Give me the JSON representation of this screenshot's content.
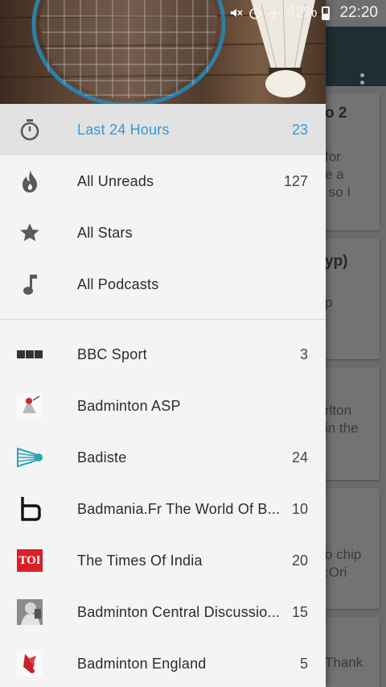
{
  "status_bar": {
    "battery": "42%",
    "time": "22:20"
  },
  "background": {
    "snippets": [
      "o 2",
      "for\ne a\n so I",
      "yp)",
      "p",
      "rlton\nin the",
      "o chip\n:Ori",
      "Thank"
    ]
  },
  "nav": [
    {
      "icon": "stopwatch-icon",
      "label": "Last 24 Hours",
      "count": "23",
      "active": true
    },
    {
      "icon": "flame-icon",
      "label": "All Unreads",
      "count": "127"
    },
    {
      "icon": "star-icon",
      "label": "All Stars",
      "count": ""
    },
    {
      "icon": "music-note-icon",
      "label": "All Podcasts",
      "count": ""
    }
  ],
  "feeds": [
    {
      "icon": "bbc-logo-icon",
      "icon_text": "BBC",
      "label": "BBC Sport",
      "count": "3"
    },
    {
      "icon": "badminton-asp-logo-icon",
      "label": "Badminton ASP",
      "count": ""
    },
    {
      "icon": "shuttlecock-icon",
      "label": "Badiste",
      "count": "24"
    },
    {
      "icon": "badmania-b-logo-icon",
      "label": "Badmania.Fr The World Of B...",
      "count": "10"
    },
    {
      "icon": "toi-logo-icon",
      "icon_text": "TOI",
      "label": "The Times Of India",
      "count": "20"
    },
    {
      "icon": "player-avatar-icon",
      "label": "Badminton Central Discussio...",
      "count": "15"
    },
    {
      "icon": "badminton-england-logo-icon",
      "label": "Badminton England",
      "count": "5"
    }
  ],
  "colors": {
    "accent": "#2f9bd6",
    "drawer_bg": "#f4f4f4",
    "active_bg": "#e2e2e2",
    "toi_red": "#d9202a"
  }
}
